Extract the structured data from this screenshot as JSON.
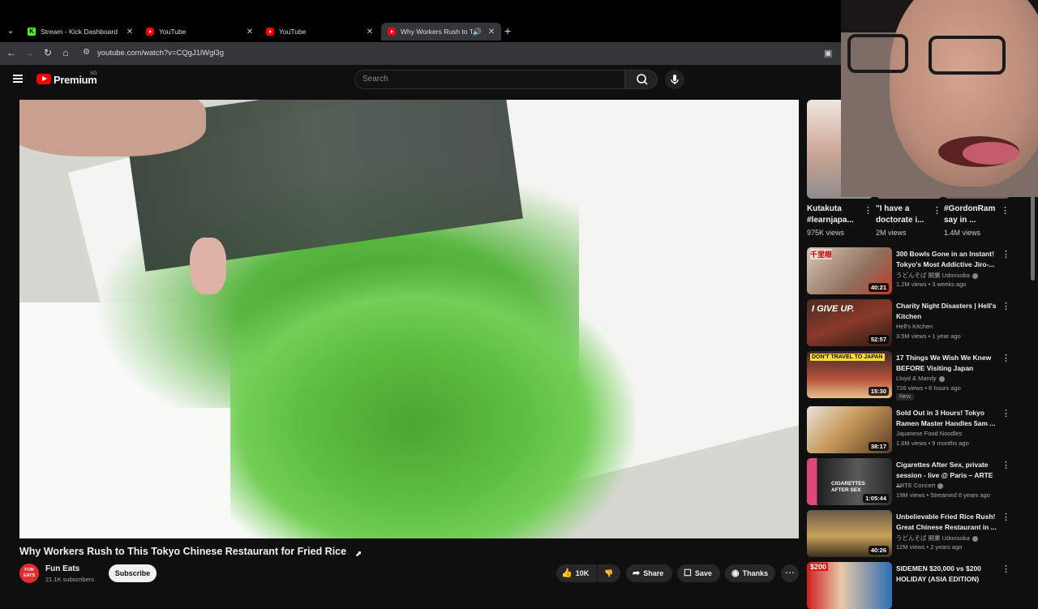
{
  "browser": {
    "tabs": [
      {
        "title": "Stream - Kick Dashboard",
        "favicon": "kick-icon",
        "active": false
      },
      {
        "title": "YouTube",
        "favicon": "youtube-icon",
        "active": false
      },
      {
        "title": "YouTube",
        "favicon": "youtube-icon",
        "active": false
      },
      {
        "title": "Why Workers Rush to This",
        "favicon": "youtube-icon",
        "active": true,
        "audio": true
      }
    ],
    "url": "youtube.com/watch?v=CQgJ1lWgl3g"
  },
  "header": {
    "brand": "Premium",
    "country_code": "SG",
    "search_placeholder": "Search"
  },
  "video": {
    "title": "Why Workers Rush to This Tokyo Chinese Restaurant for Fried Rice",
    "channel": {
      "name": "Fun Eats",
      "subscribers": "21.1K subscribers",
      "avatar_text": "FUN EATS"
    },
    "actions": {
      "subscribe": "Subscribe",
      "likes": "10K",
      "share": "Share",
      "save": "Save",
      "thanks": "Thanks"
    }
  },
  "shorts": [
    {
      "title": "Kutakuta #learnjapa...",
      "views": "975K views"
    },
    {
      "title": "\"I have a doctorate i...",
      "views": "2M views"
    },
    {
      "title": "#GordonRam say in ...",
      "views": "1.4M views"
    }
  ],
  "recommendations": [
    {
      "title": "300 Bowls Gone in an Instant! Tokyo's Most Addictive Jiro-...",
      "channel": "うどんそば 開業 Udonsoba",
      "verified": true,
      "meta": "1.2M views • 3 weeks ago",
      "duration": "40:21",
      "badge": ""
    },
    {
      "title": "Charity Night Disasters | Hell's Kitchen",
      "channel": "Hell's Kitchen",
      "verified": false,
      "meta": "3.5M views • 1 year ago",
      "duration": "52:57",
      "badge": ""
    },
    {
      "title": "17 Things We Wish We Knew BEFORE Visiting Japan",
      "channel": "Lloyd & Mandy",
      "verified": true,
      "meta": "726 views • 6 hours ago",
      "duration": "15:30",
      "badge": "New"
    },
    {
      "title": "Sold Out in 3 Hours! Tokyo Ramen Master Handles 5am ...",
      "channel": "Japanese Food Noodles",
      "verified": false,
      "meta": "1.6M views • 9 months ago",
      "duration": "38:17",
      "badge": ""
    },
    {
      "title": "Cigarettes After Sex, private session - live @ Paris – ARTE ...",
      "channel": "ARTE Concert",
      "verified": true,
      "meta": "19M views • Streamed 6 years ago",
      "duration": "1:05:44",
      "badge": ""
    },
    {
      "title": "Unbelievable Fried Rice Rush! Great Chinese Restaurant in ...",
      "channel": "うどんそば 開業 Udonsoba",
      "verified": true,
      "meta": "12M views • 2 years ago",
      "duration": "40:26",
      "badge": ""
    },
    {
      "title": "SIDEMEN $20,000 vs $200 HOLIDAY (ASIA EDITION)",
      "channel": "",
      "verified": false,
      "meta": "",
      "duration": "",
      "badge": ""
    }
  ],
  "thumb_texts": {
    "r0": "千里眼",
    "r1": "I GIVE UP.",
    "r2": "DON'T TRAVEL TO JAPAN",
    "r4": "CIGARETTES AFTER SEX",
    "r6": "$200"
  },
  "colors": {
    "background": "#0f0f0f",
    "yt_red": "#ff0000",
    "kick_green": "#53fc18",
    "text_primary": "#f1f1f1",
    "text_secondary": "#aaaaaa"
  }
}
